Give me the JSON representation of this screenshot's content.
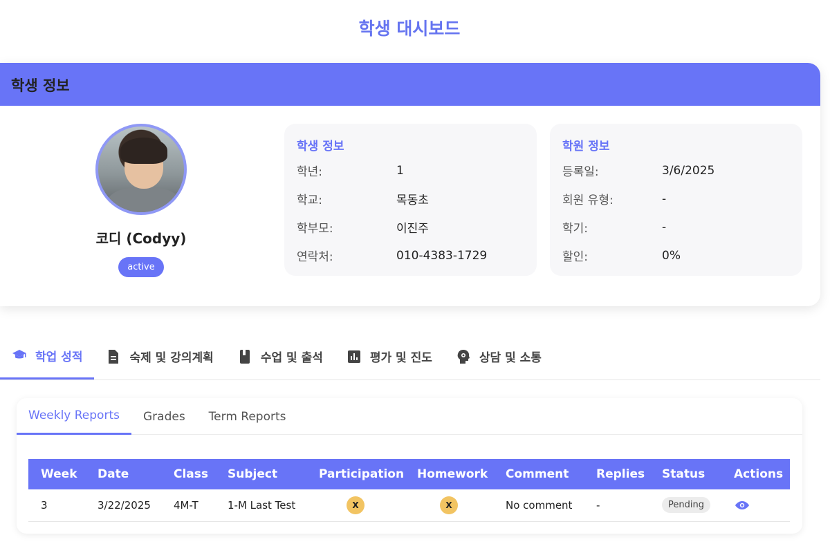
{
  "page_title": "학생 대시보드",
  "info_card": {
    "header": "학생 정보",
    "profile": {
      "name": "코디 (Codyy)",
      "status": "active"
    },
    "student_info": {
      "title": "학생 정보",
      "rows": [
        {
          "label": "학년:",
          "value": "1"
        },
        {
          "label": "학교:",
          "value": "목동초"
        },
        {
          "label": "학부모:",
          "value": "이진주"
        },
        {
          "label": "연락처:",
          "value": "010-4383-1729"
        }
      ]
    },
    "academy_info": {
      "title": "학원 정보",
      "rows": [
        {
          "label": "등록일:",
          "value": "3/6/2025"
        },
        {
          "label": "회원 유형:",
          "value": "-"
        },
        {
          "label": "학기:",
          "value": "-"
        },
        {
          "label": "할인:",
          "value": "0%"
        }
      ]
    }
  },
  "main_tabs": [
    {
      "label": "학업 성적",
      "icon": "graduation-cap-icon",
      "active": true
    },
    {
      "label": "숙제 및 강의계획",
      "icon": "document-icon",
      "active": false
    },
    {
      "label": "수업 및 출석",
      "icon": "book-icon",
      "active": false
    },
    {
      "label": "평가 및 진도",
      "icon": "bar-chart-icon",
      "active": false
    },
    {
      "label": "상담 및 소통",
      "icon": "head-gear-icon",
      "active": false
    }
  ],
  "report": {
    "sub_tabs": [
      {
        "label": "Weekly Reports",
        "active": true
      },
      {
        "label": "Grades",
        "active": false
      },
      {
        "label": "Term Reports",
        "active": false
      }
    ],
    "columns": [
      "Week",
      "Date",
      "Class",
      "Subject",
      "Participation",
      "Homework",
      "Comment",
      "Replies",
      "Status",
      "Actions"
    ],
    "rows": [
      {
        "week": "3",
        "date": "3/22/2025",
        "class": "4M-T",
        "subject": "1-M Last Test",
        "participation": "X",
        "homework": "X",
        "comment": "No comment",
        "replies": "-",
        "status": "Pending",
        "action_icon": "eye-icon"
      }
    ]
  },
  "colors": {
    "accent": "#6874f7",
    "badge_yellow": "#f2c462",
    "pending_bg": "#ececec"
  }
}
